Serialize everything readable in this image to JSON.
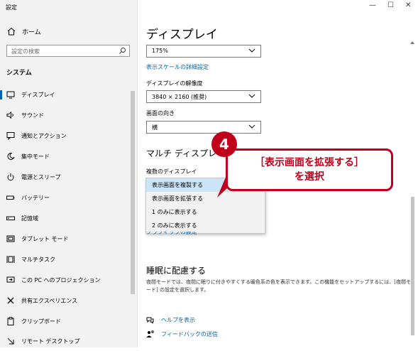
{
  "window": {
    "title": "設定",
    "min": "—",
    "max": "☐",
    "close": "✕"
  },
  "sidebar": {
    "home": "ホーム",
    "search_placeholder": "設定の検索",
    "section": "システム",
    "items": [
      {
        "label": "ディスプレイ",
        "icon": "monitor-icon",
        "selected": true
      },
      {
        "label": "サウンド",
        "icon": "speaker-icon"
      },
      {
        "label": "通知とアクション",
        "icon": "notification-icon"
      },
      {
        "label": "集中モード",
        "icon": "moon-icon"
      },
      {
        "label": "電源とスリープ",
        "icon": "power-icon"
      },
      {
        "label": "バッテリー",
        "icon": "battery-icon"
      },
      {
        "label": "記憶域",
        "icon": "storage-icon"
      },
      {
        "label": "タブレット モード",
        "icon": "tablet-icon"
      },
      {
        "label": "マルチタスク",
        "icon": "multitask-icon"
      },
      {
        "label": "この PC へのプロジェクション",
        "icon": "projection-icon"
      },
      {
        "label": "共有エクスペリエンス",
        "icon": "share-icon"
      },
      {
        "label": "クリップボード",
        "icon": "clipboard-icon"
      },
      {
        "label": "リモート デスクトップ",
        "icon": "remote-desktop-icon"
      }
    ]
  },
  "main": {
    "title": "ディスプレイ",
    "scale_value": "175%",
    "scale_link": "表示スケールの詳細設定",
    "resolution_label": "ディスプレイの解像度",
    "resolution_value": "3840 × 2160 (推奨)",
    "orientation_label": "画面の向き",
    "orientation_value": "横",
    "multi_title": "マルチ ディスプレイ",
    "multi_label": "複数のディスプレイ",
    "dropdown_options": [
      "表示画面を複製する",
      "表示画面を拡張する",
      "1 のみに表示する",
      "2 のみに表示する"
    ],
    "hidden_link_fragment": "グラフィックの設定",
    "night_title": "睡眠に配慮する",
    "night_text": "夜間モードでは、夜間に眠りに付きやすくする暖色系の色を表示できます。この機能をセットアップするには、[夜間モード] の設定を選択します。",
    "help": "ヘルプを表示",
    "feedback": "フィードバックの送信"
  },
  "annotation": {
    "badge": "4",
    "line1": "［表示画面を拡張する］",
    "line2": "を選択"
  },
  "colors": {
    "accent": "#0063b1",
    "callout": "#c0001a",
    "highlight": "#cce4f7"
  }
}
